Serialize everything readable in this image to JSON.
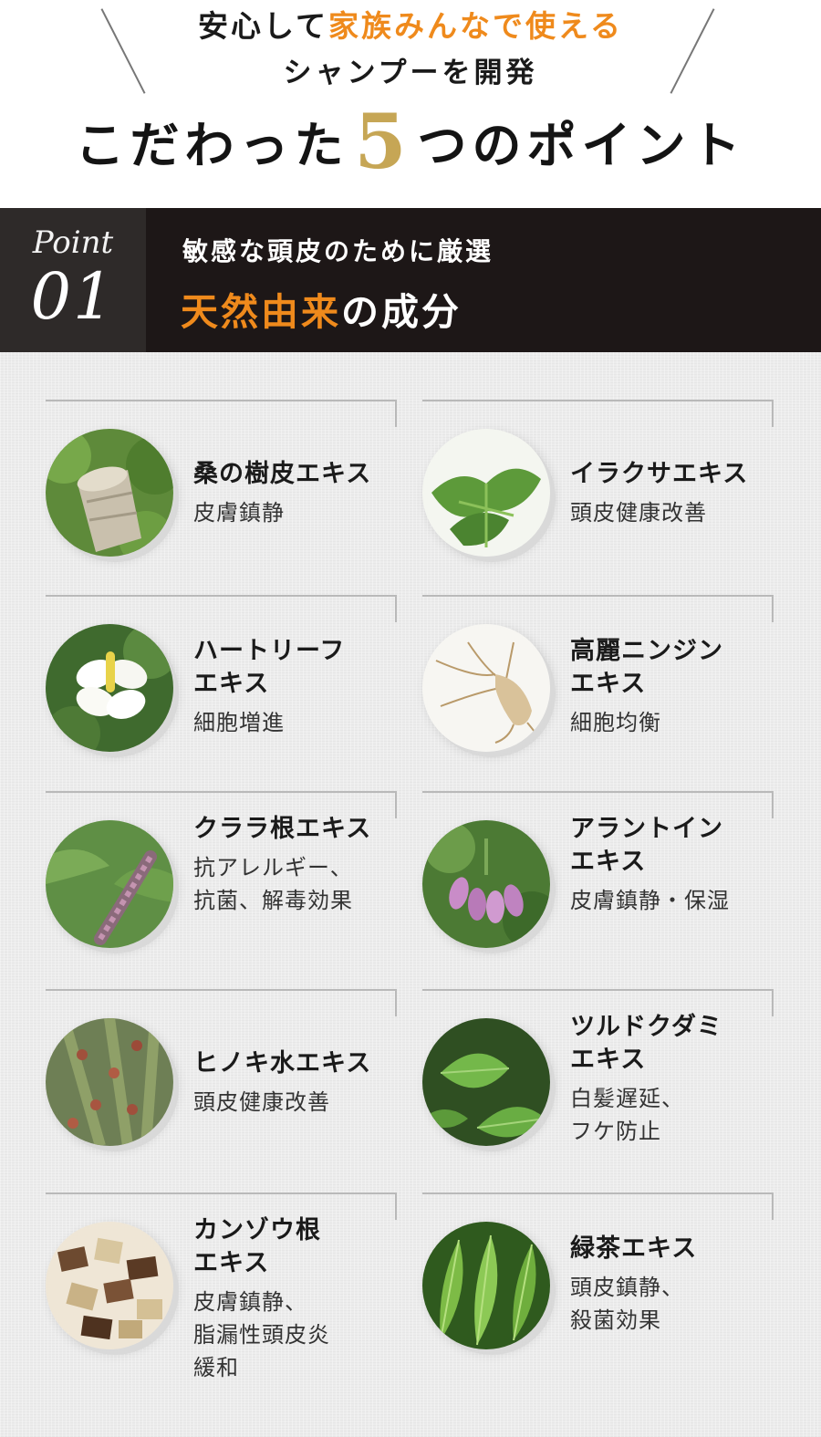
{
  "header": {
    "lead_line1_pre": "安心して",
    "lead_line1_accent": "家族みんなで使える",
    "lead_line2": "シャンプーを開発",
    "title_pre": "こだわった",
    "title_num": "5",
    "title_post": "つのポイント"
  },
  "point": {
    "label": "Point",
    "number": "01",
    "subtitle": "敏感な頭皮のために厳選",
    "title_accent": "天然由来",
    "title_post": "の成分"
  },
  "ingredients": [
    {
      "name": "桑の樹皮エキス",
      "effect": "皮膚鎮静",
      "image_icon": "mulberry-bark-icon"
    },
    {
      "name": "イラクサエキス",
      "effect": "頭皮健康改善",
      "image_icon": "nettle-icon"
    },
    {
      "name": "ハートリーフ\nエキス",
      "effect": "細胞増進",
      "image_icon": "heartleaf-flower-icon"
    },
    {
      "name": "高麗ニンジン\nエキス",
      "effect": "細胞均衡",
      "image_icon": "ginseng-root-icon"
    },
    {
      "name": "クララ根エキス",
      "effect": "抗アレルギー、\n抗菌、解毒効果",
      "image_icon": "sophora-flower-icon"
    },
    {
      "name": "アラントイン\nエキス",
      "effect": "皮膚鎮静・保湿",
      "image_icon": "comfrey-flower-icon"
    },
    {
      "name": "ヒノキ水エキス",
      "effect": "頭皮健康改善",
      "image_icon": "hinoki-branch-icon"
    },
    {
      "name": "ツルドクダミ\nエキス",
      "effect": "白髪遅延、\nフケ防止",
      "image_icon": "fallopia-leaf-icon"
    },
    {
      "name": "カンゾウ根\nエキス",
      "effect": "皮膚鎮静、\n脂漏性頭皮炎\n緩和",
      "image_icon": "licorice-root-icon"
    },
    {
      "name": "緑茶エキス",
      "effect": "頭皮鎮静、\n殺菌効果",
      "image_icon": "green-tea-leaf-icon"
    }
  ],
  "colors": {
    "accent_orange": "#ef8a1c",
    "accent_gold": "#c6a655",
    "band_dark": "#1d1717",
    "band_tag": "#2e2a29"
  }
}
